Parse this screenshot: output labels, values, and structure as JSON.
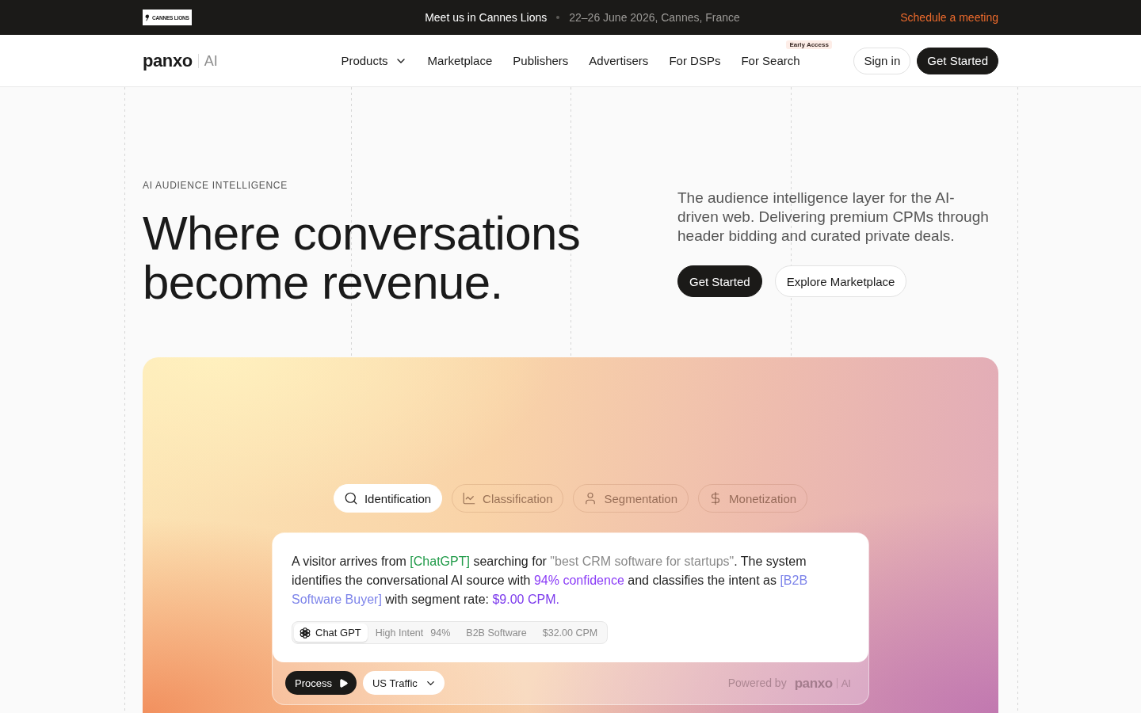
{
  "announcement": {
    "logo_text": "CANNES LIONS",
    "headline": "Meet us in Cannes Lions",
    "details": "22–26 June 2026, Cannes, France",
    "link": "Schedule a meeting"
  },
  "navbar": {
    "brand": {
      "name": "panxo",
      "suffix": "AI"
    },
    "items": [
      {
        "label": "Products",
        "kind": "dropdown"
      },
      {
        "label": "Marketplace",
        "kind": "link"
      },
      {
        "label": "Publishers",
        "kind": "link"
      },
      {
        "label": "Advertisers",
        "kind": "link"
      },
      {
        "label": "For DSPs",
        "kind": "link"
      },
      {
        "label": "For Search",
        "kind": "link",
        "badge": "Early Access"
      }
    ],
    "actions": [
      {
        "label": "Sign in",
        "kind": "secondary"
      },
      {
        "label": "Get Started",
        "kind": "primary"
      }
    ]
  },
  "hero": {
    "eyebrow": "AI AUDIENCE INTELLIGENCE",
    "headline": "Where conversations become revenue.",
    "description": "The audience intelligence layer for the AI-driven web. Delivering premium CPMs through header bidding and curated private deals.",
    "buttons": [
      {
        "label": "Get Started",
        "kind": "primary"
      },
      {
        "label": "Explore Marketplace",
        "kind": "secondary"
      }
    ]
  },
  "demo": {
    "tabs": [
      {
        "label": "Identification",
        "selected": true
      },
      {
        "label": "Classification",
        "selected": false
      },
      {
        "label": "Segmentation",
        "selected": false
      },
      {
        "label": "Monetization",
        "selected": false
      }
    ],
    "description": [
      {
        "kind": "plain",
        "text": "A visitor arrives from "
      },
      {
        "kind": "source",
        "text": "[ChatGPT]"
      },
      {
        "kind": "plain",
        "text": " searching for "
      },
      {
        "kind": "query",
        "text": "\"best CRM software for startups\""
      },
      {
        "kind": "plain",
        "text": ". The system identifies the conversational AI source with "
      },
      {
        "kind": "confidence",
        "text": "94% confidence"
      },
      {
        "kind": "plain",
        "text": " and classifies the intent as "
      },
      {
        "kind": "segment",
        "text": "[B2B Software Buyer]"
      },
      {
        "kind": "plain",
        "text": " with segment rate: "
      },
      {
        "kind": "price",
        "text": "$9.00 CPM."
      }
    ],
    "tags": {
      "source": "Chat GPT",
      "items": [
        {
          "label": "High Intent",
          "value": "94%"
        },
        {
          "label": "B2B Software"
        },
        {
          "label": "$32.00 CPM"
        }
      ]
    },
    "controls": {
      "process": "Process",
      "region": "US Traffic"
    },
    "footer": {
      "powered_by": "Powered by",
      "brand": {
        "name": "panxo",
        "suffix": "AI"
      }
    }
  }
}
